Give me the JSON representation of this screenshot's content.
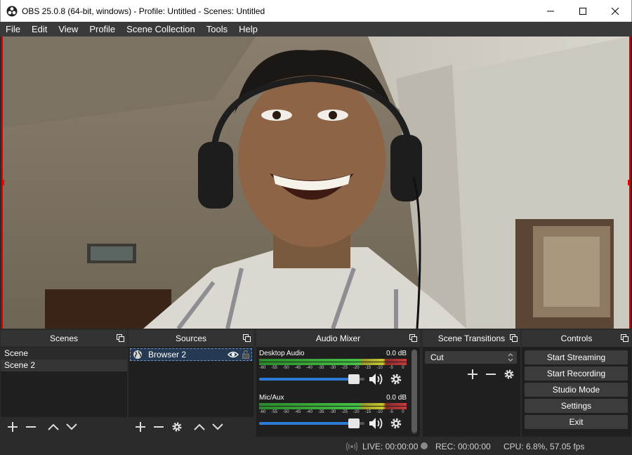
{
  "window": {
    "title": "OBS 25.0.8 (64-bit, windows) - Profile: Untitled - Scenes: Untitled"
  },
  "menu": [
    "File",
    "Edit",
    "View",
    "Profile",
    "Scene Collection",
    "Tools",
    "Help"
  ],
  "docks": {
    "scenes": {
      "title": "Scenes",
      "items": [
        "Scene",
        "Scene 2"
      ],
      "selected": 0
    },
    "sources": {
      "title": "Sources",
      "items": [
        {
          "name": "Browser 2",
          "icon": "globe-icon",
          "visible": true,
          "locked": false
        }
      ]
    },
    "mixer": {
      "title": "Audio Mixer",
      "channels": [
        {
          "name": "Desktop Audio",
          "db": "0.0 dB",
          "volume": 0.95
        },
        {
          "name": "Mic/Aux",
          "db": "0.0 dB",
          "volume": 0.95
        }
      ],
      "ticks": [
        "-60",
        "-55",
        "-50",
        "-45",
        "-40",
        "-35",
        "-30",
        "-25",
        "-20",
        "-15",
        "-10",
        "-5",
        "0"
      ]
    },
    "transitions": {
      "title": "Scene Transitions",
      "selected": "Cut"
    },
    "controls": {
      "title": "Controls",
      "buttons": [
        "Start Streaming",
        "Start Recording",
        "Studio Mode",
        "Settings",
        "Exit"
      ]
    }
  },
  "status": {
    "live": "LIVE: 00:00:00",
    "rec": "REC: 00:00:00",
    "cpu": "CPU: 6.8%, 57.05 fps"
  },
  "colors": {
    "accent": "#2d7bd6",
    "selection_border": "#5a8fd0",
    "red_border": "#dd0000"
  }
}
